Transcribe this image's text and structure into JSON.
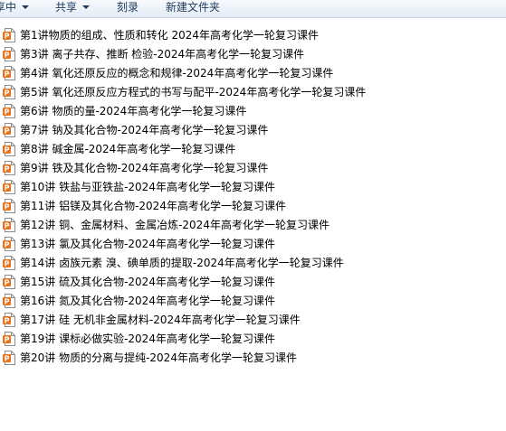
{
  "toolbar": {
    "items": [
      {
        "label": "享中",
        "has_dropdown": true
      },
      {
        "label": "共享",
        "has_dropdown": true
      },
      {
        "label": "刻录",
        "has_dropdown": false
      },
      {
        "label": "新建文件夹",
        "has_dropdown": false
      }
    ]
  },
  "file_icon": {
    "name": "powerpoint-file-icon",
    "color": "#e8731c",
    "letter": "P"
  },
  "files": [
    {
      "name": "第1讲物质的组成、性质和转化 2024年高考化学一轮复习课件"
    },
    {
      "name": "第3讲 离子共存、推断 检验-2024年高考化学一轮复习课件"
    },
    {
      "name": "第4讲 氧化还原反应的概念和规律-2024年高考化学一轮复习课件"
    },
    {
      "name": "第5讲 氧化还原反应方程式的书写与配平-2024年高考化学一轮复习课件"
    },
    {
      "name": "第6讲 物质的量-2024年高考化学一轮复习课件"
    },
    {
      "name": "第7讲 钠及其化合物-2024年高考化学一轮复习课件"
    },
    {
      "name": "第8讲 碱金属-2024年高考化学一轮复习课件"
    },
    {
      "name": "第9讲 铁及其化合物-2024年高考化学一轮复习课件"
    },
    {
      "name": "第10讲 铁盐与亚铁盐-2024年高考化学一轮复习课件"
    },
    {
      "name": "第11讲 铝镁及其化合物-2024年高考化学一轮复习课件"
    },
    {
      "name": "第12讲 铜、金属材料、金属冶炼-2024年高考化学一轮复习课件"
    },
    {
      "name": "第13讲 氯及其化合物-2024年高考化学一轮复习课件"
    },
    {
      "name": "第14讲 卤族元素 溴、碘单质的提取-2024年高考化学一轮复习课件"
    },
    {
      "name": "第15讲 硫及其化合物-2024年高考化学一轮复习课件"
    },
    {
      "name": "第16讲 氮及其化合物-2024年高考化学一轮复习课件"
    },
    {
      "name": "第17讲 硅 无机非金属材料-2024年高考化学一轮复习课件"
    },
    {
      "name": "第19讲 课标必做实验-2024年高考化学一轮复习课件"
    },
    {
      "name": "第20讲 物质的分离与提纯-2024年高考化学一轮复习课件"
    }
  ]
}
